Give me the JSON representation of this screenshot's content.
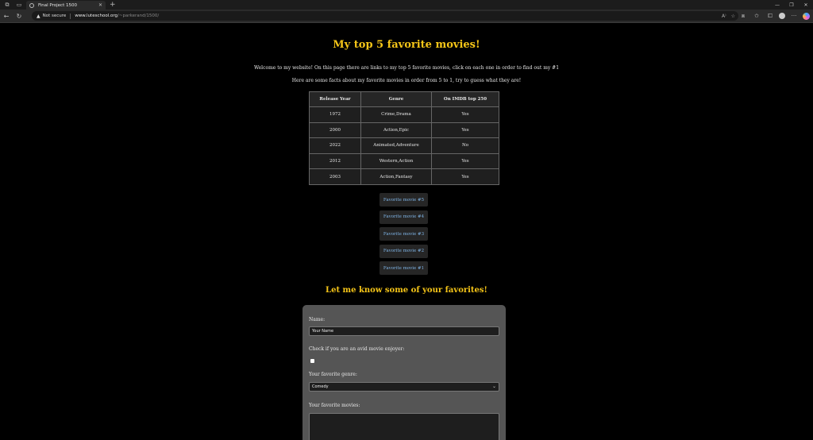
{
  "browser": {
    "tab_title": "Final Project 1500",
    "security_label": "Not secure",
    "url_host": "www.luteschool.org",
    "url_path": "/~parkerand/1500/"
  },
  "page": {
    "title": "My top 5 favorite movies!",
    "intro_1": "Welcome to my website! On this page there are links to my top 5 favorite movies, click on each one in order to find out my #1",
    "intro_2": "Here are some facts about my favorite movies in order from 5 to 1, try to guess what they are!",
    "table": {
      "headers": [
        "Release Year",
        "Genre",
        "On IMDB top 250"
      ],
      "rows": [
        [
          "1972",
          "Crime,Drama",
          "Yes"
        ],
        [
          "2000",
          "Action,Epic",
          "Yes"
        ],
        [
          "2022",
          "Animated,Adventure",
          "No"
        ],
        [
          "2012",
          "Western,Action",
          "Yes"
        ],
        [
          "2003",
          "Action,Fantasy",
          "Yes"
        ]
      ]
    },
    "favorite_links": [
      "Favorite movie #5",
      "Favorite movie #4",
      "Favorite movie #3",
      "Favorite movie #2",
      "Favorite movie #1"
    ],
    "form_heading": "Let me know some of your favorites!",
    "form": {
      "name_label": "Name:",
      "name_value": "Your Name",
      "avid_label": "Check if you are an avid movie enjoyer:",
      "genre_label": "Your favorite genre:",
      "genre_value": "Comedy",
      "movies_label": "Your favorite movies:"
    }
  },
  "colors": {
    "accent": "#f5c518",
    "link": "#7fb4e6",
    "background": "#000000",
    "form_background": "#555555"
  },
  "icons": [
    "workspaces-icon",
    "tab-actions-icon",
    "globe-icon",
    "close-icon",
    "new-tab-icon",
    "minimize-icon",
    "maximize-icon",
    "window-close-icon",
    "back-icon",
    "refresh-icon",
    "warning-icon",
    "read-aloud-icon",
    "favorite-star-icon",
    "split-screen-icon",
    "collections-icon",
    "profile-icon",
    "more-icon",
    "copilot-icon"
  ]
}
